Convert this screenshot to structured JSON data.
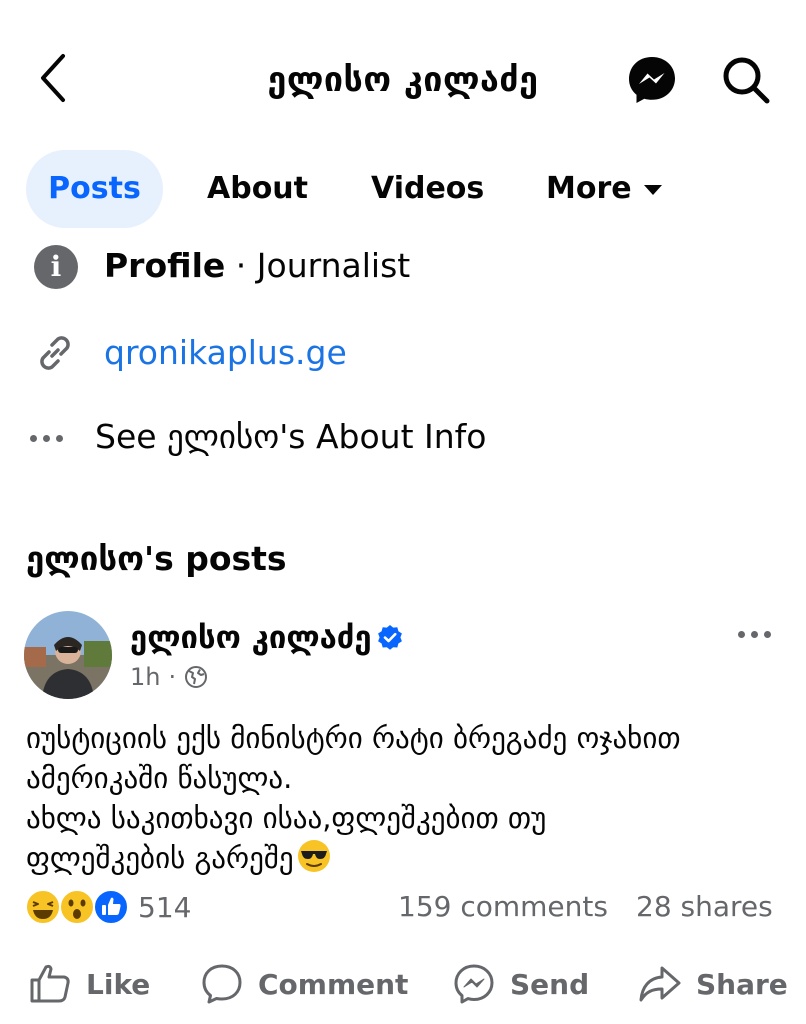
{
  "header": {
    "title": "ელისო კილაძე",
    "back_icon": "chevron-left-icon",
    "messenger_icon": "messenger-icon",
    "search_icon": "search-icon"
  },
  "tabs": [
    {
      "label": "Posts",
      "active": true
    },
    {
      "label": "About",
      "active": false
    },
    {
      "label": "Videos",
      "active": false
    },
    {
      "label": "More",
      "active": false
    }
  ],
  "intro": {
    "profile_label": "Profile",
    "profile_separator": " · ",
    "profile_category": "Journalist",
    "website": "qronikaplus.ge",
    "about_info": "See ელისო's About Info"
  },
  "posts_heading": "ელისო's posts",
  "post": {
    "author": "ელისო კილაძე",
    "verified": true,
    "time": "1h",
    "meta_separator": "·",
    "audience_icon": "globe-icon",
    "text_lines": [
      "იუსტიციის ექს მინისტრი რატი ბრეგაძე ოჯახით",
      "ამერიკაში წასულა.",
      "ახლა საკითხავი ისაა,ფლეშკებით თუ",
      "ფლეშკების გარეშე"
    ],
    "trailing_emoji": "smiling-face-with-sunglasses",
    "reactions": [
      "haha",
      "wow",
      "like"
    ],
    "reaction_count": "514",
    "comments": "159 comments",
    "shares": "28 shares"
  },
  "actions": {
    "like": "Like",
    "comment": "Comment",
    "send": "Send",
    "share": "Share"
  },
  "colors": {
    "accent": "#0866ff",
    "active_tab_bg": "#e7f0fd",
    "link": "#1b74e4",
    "secondary_text": "#65676b"
  }
}
